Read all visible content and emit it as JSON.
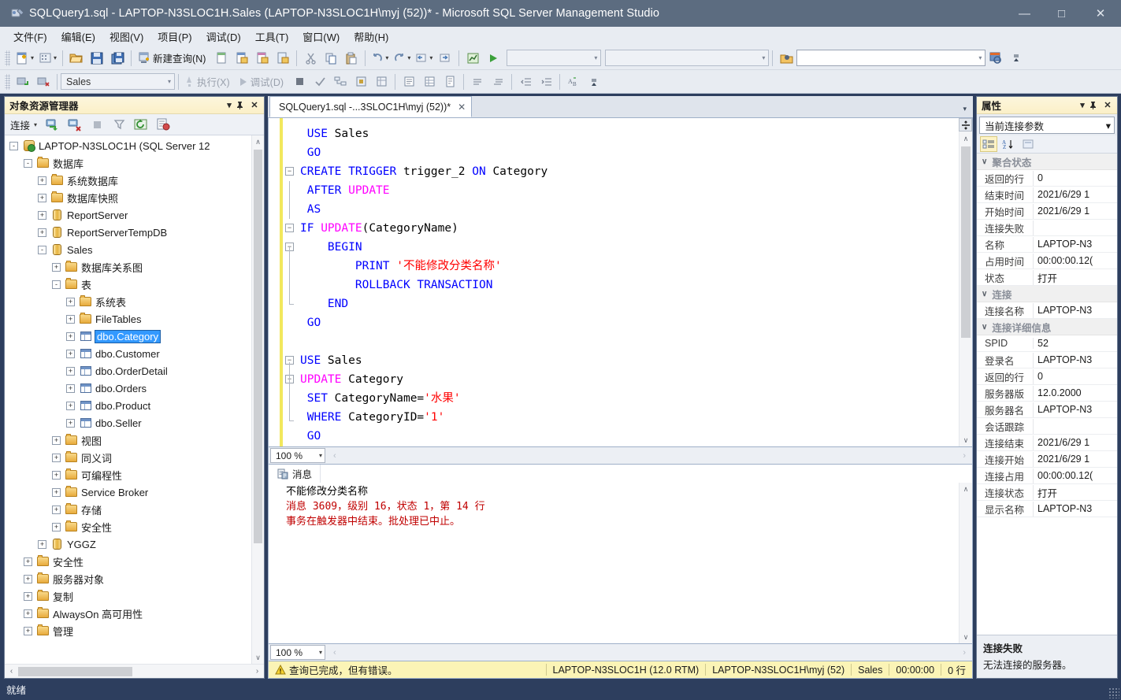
{
  "window": {
    "title": "SQLQuery1.sql - LAPTOP-N3SLOC1H.Sales (LAPTOP-N3SLOC1H\\myj (52))* - Microsoft SQL Server Management Studio",
    "minimize": "—",
    "maximize": "□",
    "close": "✕"
  },
  "menu": {
    "items": [
      {
        "label": "文件(F)"
      },
      {
        "label": "编辑(E)"
      },
      {
        "label": "视图(V)"
      },
      {
        "label": "项目(P)"
      },
      {
        "label": "调试(D)"
      },
      {
        "label": "工具(T)"
      },
      {
        "label": "窗口(W)"
      },
      {
        "label": "帮助(H)"
      }
    ]
  },
  "toolbar_main": {
    "new_query_label": "新建查询(N)",
    "icons": [
      "new-item-icon",
      "new-project-icon",
      "open-file-icon",
      "save-icon",
      "save-all-icon",
      "new-query-icon",
      "db-engine-query-icon",
      "analysis-mdx-query-icon",
      "analysis-dmx-query-icon",
      "analysis-xmla-query-icon",
      "cut-icon",
      "copy-icon",
      "paste-icon",
      "undo-icon",
      "redo-icon",
      "navigate-backward-icon",
      "navigate-forward-icon",
      "solution-explorer-icon"
    ],
    "find_placeholder": ""
  },
  "toolbar_query": {
    "database_value": "Sales",
    "execute_label": "执行(X)",
    "debug_label": "调试(D)",
    "icons": [
      "connect-icon",
      "disconnect-icon",
      "execute-icon",
      "debug-icon",
      "stop-icon",
      "parse-icon",
      "display-estimated-plan-icon",
      "query-options-icon",
      "include-actual-plan-icon",
      "include-client-statistics-icon",
      "results-to-text-icon",
      "results-to-grid-icon",
      "results-to-file-icon",
      "comment-icon",
      "uncomment-icon",
      "decrease-indent-icon",
      "increase-indent-icon",
      "spell-check-icon"
    ]
  },
  "object_explorer": {
    "title": "对象资源管理器",
    "connect_label": "连接",
    "toolbar_icons": [
      "connect-object-explorer-icon",
      "disconnect-object-explorer-icon",
      "stop-icon",
      "filter-icon",
      "refresh-icon",
      "report-icon"
    ],
    "header_buttons": {
      "dropdown": "▾",
      "pin": "⌐",
      "close": "✕"
    },
    "tree": [
      {
        "indent": 0,
        "expander": "-",
        "icon": "server-icon",
        "label": "LAPTOP-N3SLOC1H (SQL Server 12",
        "selected": false
      },
      {
        "indent": 1,
        "expander": "-",
        "icon": "folder-icon",
        "label": "数据库",
        "selected": false
      },
      {
        "indent": 2,
        "expander": "+",
        "icon": "folder-icon",
        "label": "系统数据库",
        "selected": false
      },
      {
        "indent": 2,
        "expander": "+",
        "icon": "folder-icon",
        "label": "数据库快照",
        "selected": false
      },
      {
        "indent": 2,
        "expander": "+",
        "icon": "database-icon",
        "label": "ReportServer",
        "selected": false
      },
      {
        "indent": 2,
        "expander": "+",
        "icon": "database-icon",
        "label": "ReportServerTempDB",
        "selected": false
      },
      {
        "indent": 2,
        "expander": "-",
        "icon": "database-icon",
        "label": "Sales",
        "selected": false
      },
      {
        "indent": 3,
        "expander": "+",
        "icon": "folder-icon",
        "label": "数据库关系图",
        "selected": false
      },
      {
        "indent": 3,
        "expander": "-",
        "icon": "folder-icon",
        "label": "表",
        "selected": false
      },
      {
        "indent": 4,
        "expander": "+",
        "icon": "folder-icon",
        "label": "系统表",
        "selected": false
      },
      {
        "indent": 4,
        "expander": "+",
        "icon": "folder-icon",
        "label": "FileTables",
        "selected": false
      },
      {
        "indent": 4,
        "expander": "+",
        "icon": "table-icon",
        "label": "dbo.Category",
        "selected": true
      },
      {
        "indent": 4,
        "expander": "+",
        "icon": "table-icon",
        "label": "dbo.Customer",
        "selected": false
      },
      {
        "indent": 4,
        "expander": "+",
        "icon": "table-icon",
        "label": "dbo.OrderDetail",
        "selected": false
      },
      {
        "indent": 4,
        "expander": "+",
        "icon": "table-icon",
        "label": "dbo.Orders",
        "selected": false
      },
      {
        "indent": 4,
        "expander": "+",
        "icon": "table-icon",
        "label": "dbo.Product",
        "selected": false
      },
      {
        "indent": 4,
        "expander": "+",
        "icon": "table-icon",
        "label": "dbo.Seller",
        "selected": false
      },
      {
        "indent": 3,
        "expander": "+",
        "icon": "folder-icon",
        "label": "视图",
        "selected": false
      },
      {
        "indent": 3,
        "expander": "+",
        "icon": "folder-icon",
        "label": "同义词",
        "selected": false
      },
      {
        "indent": 3,
        "expander": "+",
        "icon": "folder-icon",
        "label": "可编程性",
        "selected": false
      },
      {
        "indent": 3,
        "expander": "+",
        "icon": "folder-icon",
        "label": "Service Broker",
        "selected": false
      },
      {
        "indent": 3,
        "expander": "+",
        "icon": "folder-icon",
        "label": "存储",
        "selected": false
      },
      {
        "indent": 3,
        "expander": "+",
        "icon": "folder-icon",
        "label": "安全性",
        "selected": false
      },
      {
        "indent": 2,
        "expander": "+",
        "icon": "database-icon",
        "label": "YGGZ",
        "selected": false
      },
      {
        "indent": 1,
        "expander": "+",
        "icon": "folder-icon",
        "label": "安全性",
        "selected": false
      },
      {
        "indent": 1,
        "expander": "+",
        "icon": "folder-icon",
        "label": "服务器对象",
        "selected": false
      },
      {
        "indent": 1,
        "expander": "+",
        "icon": "folder-icon",
        "label": "复制",
        "selected": false
      },
      {
        "indent": 1,
        "expander": "+",
        "icon": "folder-icon",
        "label": "AlwaysOn 高可用性",
        "selected": false
      },
      {
        "indent": 1,
        "expander": "+",
        "icon": "folder-icon",
        "label": "管理",
        "selected": false
      }
    ]
  },
  "editor": {
    "tab_label": "SQLQuery1.sql -...3SLOC1H\\myj (52))*",
    "tab_close": "✕",
    "zoom": "100 %",
    "lines": [
      {
        "fold": "",
        "indent": 1,
        "tokens": [
          {
            "t": "USE",
            "c": "k"
          },
          {
            "t": " Sales",
            "c": "pl"
          }
        ]
      },
      {
        "fold": "",
        "indent": 1,
        "tokens": [
          {
            "t": "GO",
            "c": "k"
          }
        ]
      },
      {
        "fold": "-",
        "indent": 0,
        "tokens": [
          {
            "t": "CREATE TRIGGER",
            "c": "k"
          },
          {
            "t": " trigger_2 ",
            "c": "pl"
          },
          {
            "t": "ON",
            "c": "k"
          },
          {
            "t": " Category",
            "c": "pl"
          }
        ]
      },
      {
        "fold": "",
        "indent": 1,
        "tokens": [
          {
            "t": "AFTER ",
            "c": "k"
          },
          {
            "t": "UPDATE",
            "c": "k2"
          }
        ]
      },
      {
        "fold": "",
        "indent": 1,
        "tokens": [
          {
            "t": "AS",
            "c": "k"
          }
        ]
      },
      {
        "fold": "-",
        "indent": 0,
        "tokens": [
          {
            "t": "IF ",
            "c": "k"
          },
          {
            "t": "UPDATE",
            "c": "k2"
          },
          {
            "t": "(CategoryName)",
            "c": "pl"
          }
        ]
      },
      {
        "fold": "-",
        "indent": 4,
        "tokens": [
          {
            "t": "BEGIN",
            "c": "k"
          }
        ]
      },
      {
        "fold": "",
        "indent": 8,
        "tokens": [
          {
            "t": "PRINT ",
            "c": "k"
          },
          {
            "t": "'不能修改分类名称'",
            "c": "str"
          }
        ]
      },
      {
        "fold": "",
        "indent": 8,
        "tokens": [
          {
            "t": "ROLLBACK TRANSACTION",
            "c": "k"
          }
        ]
      },
      {
        "fold": "",
        "indent": 4,
        "tokens": [
          {
            "t": "END",
            "c": "k"
          }
        ]
      },
      {
        "fold": "",
        "indent": 1,
        "tokens": [
          {
            "t": "GO",
            "c": "k"
          }
        ]
      },
      {
        "fold": "",
        "indent": 1,
        "tokens": [
          {
            "t": "",
            "c": "pl"
          }
        ]
      },
      {
        "fold": "-",
        "indent": 0,
        "tokens": [
          {
            "t": "USE",
            "c": "k"
          },
          {
            "t": " Sales",
            "c": "pl"
          }
        ]
      },
      {
        "fold": "-",
        "indent": 0,
        "tokens": [
          {
            "t": "UPDATE",
            "c": "k2"
          },
          {
            "t": " Category",
            "c": "pl"
          }
        ]
      },
      {
        "fold": "",
        "indent": 1,
        "tokens": [
          {
            "t": "SET",
            "c": "k"
          },
          {
            "t": " CategoryName=",
            "c": "pl"
          },
          {
            "t": "'水果'",
            "c": "str"
          }
        ]
      },
      {
        "fold": "",
        "indent": 1,
        "tokens": [
          {
            "t": "WHERE",
            "c": "k"
          },
          {
            "t": " CategoryID=",
            "c": "pl"
          },
          {
            "t": "'1'",
            "c": "str"
          }
        ]
      },
      {
        "fold": "",
        "indent": 1,
        "tokens": [
          {
            "t": "GO",
            "c": "k"
          }
        ]
      }
    ]
  },
  "results": {
    "zoom": "100 %",
    "tab_label": "消息",
    "tab_icon": "messages-icon",
    "messages": [
      {
        "text": "不能修改分类名称",
        "error": false
      },
      {
        "text": "消息 3609，级别 16，状态 1，第 14 行",
        "error": true
      },
      {
        "text": "事务在触发器中结束。批处理已中止。",
        "error": true
      }
    ]
  },
  "query_status": {
    "icon": "warning-icon",
    "state": "查询已完成，但有错误。",
    "server": "LAPTOP-N3SLOC1H (12.0 RTM)",
    "user": "LAPTOP-N3SLOC1H\\myj (52)",
    "database": "Sales",
    "elapsed": "00:00:00",
    "rows": "0 行"
  },
  "properties": {
    "title": "属性",
    "header_buttons": {
      "dropdown": "▾",
      "pin": "⌐",
      "close": "✕"
    },
    "selector": "当前连接参数",
    "toolbar_icons": [
      "categorized-icon",
      "alphabetical-icon",
      "property-pages-icon"
    ],
    "groups": [
      {
        "name": "聚合状态",
        "rows": [
          {
            "key": "返回的行",
            "value": "0"
          },
          {
            "key": "结束时间",
            "value": "2021/6/29 1"
          },
          {
            "key": "开始时间",
            "value": "2021/6/29 1"
          },
          {
            "key": "连接失败",
            "value": ""
          },
          {
            "key": "名称",
            "value": "LAPTOP-N3"
          },
          {
            "key": "占用时间",
            "value": "00:00:00.12("
          },
          {
            "key": "状态",
            "value": "打开"
          }
        ]
      },
      {
        "name": "连接",
        "rows": [
          {
            "key": "连接名称",
            "value": "LAPTOP-N3"
          }
        ]
      },
      {
        "name": "连接详细信息",
        "rows": [
          {
            "key": "SPID",
            "value": "52"
          },
          {
            "key": "登录名",
            "value": "LAPTOP-N3"
          },
          {
            "key": "返回的行",
            "value": "0"
          },
          {
            "key": "服务器版",
            "value": "12.0.2000"
          },
          {
            "key": "服务器名",
            "value": "LAPTOP-N3"
          },
          {
            "key": "会话跟踪",
            "value": ""
          },
          {
            "key": "连接结束",
            "value": "2021/6/29 1"
          },
          {
            "key": "连接开始",
            "value": "2021/6/29 1"
          },
          {
            "key": "连接占用",
            "value": "00:00:00.12("
          },
          {
            "key": "连接状态",
            "value": "打开"
          },
          {
            "key": "显示名称",
            "value": "LAPTOP-N3"
          }
        ]
      }
    ],
    "description": {
      "title": "连接失败",
      "text": "无法连接的服务器。"
    }
  },
  "statusbar": {
    "text": "就绪"
  },
  "colors": {
    "title_bar": "#5c6c80",
    "chrome": "#2d3e5e",
    "keyword_blue": "#0000ff",
    "keyword_magenta": "#ff00ff",
    "string_red": "#ff0000",
    "error_red": "#c00000",
    "selection_blue": "#3399ff",
    "status_yellow": "#fbf4b6",
    "panel_header_yellow": "#fdf6dd"
  }
}
